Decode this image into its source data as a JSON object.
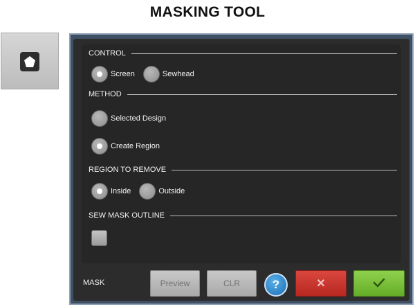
{
  "title": "MASKING TOOL",
  "tool_button": {
    "icon": "pentagon-mask-icon"
  },
  "sections": {
    "control": {
      "label": "CONTROL",
      "options": [
        {
          "label": "Screen",
          "selected": true
        },
        {
          "label": "Sewhead",
          "selected": false
        }
      ]
    },
    "method": {
      "label": "METHOD",
      "options": [
        {
          "label": "Selected Design",
          "selected": false
        },
        {
          "label": "Create Region",
          "selected": true
        }
      ]
    },
    "region_to_remove": {
      "label": "REGION TO REMOVE",
      "options": [
        {
          "label": "Inside",
          "selected": true
        },
        {
          "label": "Outside",
          "selected": false
        }
      ]
    },
    "sew_mask_outline": {
      "label": "SEW MASK OUTLINE",
      "checked": false
    }
  },
  "footer": {
    "mask_label": "MASK",
    "preview_label": "Preview",
    "clr_label": "CLR",
    "help_label": "?",
    "cancel_label": "✕",
    "ok_icon": "checkmark-icon"
  },
  "colors": {
    "frame": "#3f5064",
    "panel": "#2c2c2c",
    "cancel": "#c8342c",
    "ok": "#7cc03a",
    "help": "#2a86cc"
  }
}
